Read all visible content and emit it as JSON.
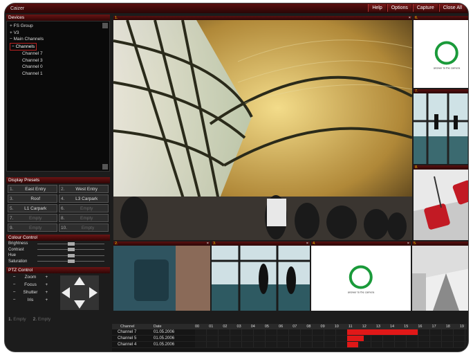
{
  "window": {
    "title": "Caizer"
  },
  "menu": {
    "help": "Help",
    "options": "Options",
    "capture": "Capture",
    "close_all": "Close All"
  },
  "devices": {
    "header": "Devices",
    "items": [
      {
        "label": "+ FS Group"
      },
      {
        "label": "+ V3"
      },
      {
        "label": "− Main Channels"
      }
    ],
    "selected": "− Channels",
    "channels": [
      "Channel 7",
      "Channel 3",
      "Channel 0",
      "Channel 1"
    ]
  },
  "presets": {
    "header": "Display Presets",
    "buttons": [
      {
        "num": "1.",
        "label": "East Entry"
      },
      {
        "num": "2.",
        "label": "West Entry"
      },
      {
        "num": "3.",
        "label": "Roof"
      },
      {
        "num": "4.",
        "label": "L3 Carpark"
      },
      {
        "num": "5.",
        "label": "L1 Carpark"
      },
      {
        "num": "6.",
        "label": "Empty"
      },
      {
        "num": "7.",
        "label": "Empty"
      },
      {
        "num": "8.",
        "label": "Empty"
      },
      {
        "num": "9.",
        "label": "Empty"
      },
      {
        "num": "10.",
        "label": "Empty"
      }
    ]
  },
  "color_control": {
    "header": "Colour Control",
    "rows": [
      {
        "label": "Brightness",
        "level": 0.5
      },
      {
        "label": "Contrast",
        "level": 0.5
      },
      {
        "label": "Hue",
        "level": 0.5
      },
      {
        "label": "Saturation",
        "level": 0.5
      }
    ]
  },
  "ptz": {
    "header": "PTZ Control",
    "rows": [
      {
        "label": "Zoom"
      },
      {
        "label": "Focus"
      },
      {
        "label": "Shutter"
      },
      {
        "label": "Iris"
      }
    ],
    "bottom": [
      {
        "num": "1.",
        "label": "Empty"
      },
      {
        "num": "2.",
        "label": "Empty"
      }
    ]
  },
  "cells": {
    "main": {
      "num": "1.",
      "close": "×"
    },
    "c6": {
      "num": "6."
    },
    "c7": {
      "num": "7."
    },
    "c8": {
      "num": "8."
    },
    "c2": {
      "num": "2.",
      "close": "×"
    },
    "c3": {
      "num": "3.",
      "close": "×"
    },
    "c4": {
      "num": "4.",
      "close": "×"
    },
    "c5": {
      "num": "5."
    },
    "logo_tagline": "answer to the camera"
  },
  "timeline": {
    "col_channel": "Channel",
    "col_date": "Date",
    "hours": [
      "00",
      "01",
      "02",
      "03",
      "04",
      "05",
      "06",
      "07",
      "08",
      "09",
      "10",
      "11",
      "12",
      "13",
      "14",
      "15",
      "16",
      "17",
      "18",
      "19"
    ],
    "rows": [
      {
        "channel": "Channel 7",
        "date": "01.05.2006"
      },
      {
        "channel": "Channel 5",
        "date": "01.05.2006"
      },
      {
        "channel": "Channel 4",
        "date": "01.05.2006"
      }
    ]
  },
  "colors": {
    "accent": "#6a1414",
    "record": "#e01818"
  }
}
